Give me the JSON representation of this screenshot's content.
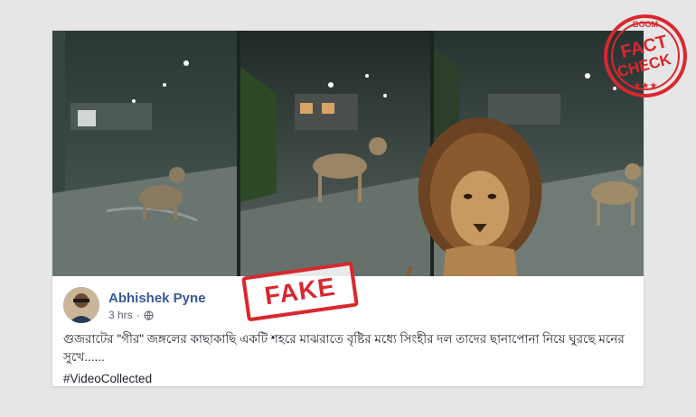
{
  "post": {
    "author": "Abhishek Pyne",
    "time": "3 hrs",
    "privacy_icon": "globe-icon",
    "text": "গুজরাটের \"গীর\" জঙ্গলের কাছাকাছি একটি শহরে মাঝরাতে বৃষ্টির মধ্যে সিংহীর দল তাদের ছানাপোনা নিয়ে ঘুরছে মনের সুখে......",
    "hashtag": "#VideoCollected"
  },
  "stamp": {
    "fake_label": "FAKE"
  },
  "badge": {
    "brand": "BOOM",
    "line1": "FACT",
    "line2": "CHECK",
    "stars": "★★★",
    "color": "#d9272e"
  }
}
